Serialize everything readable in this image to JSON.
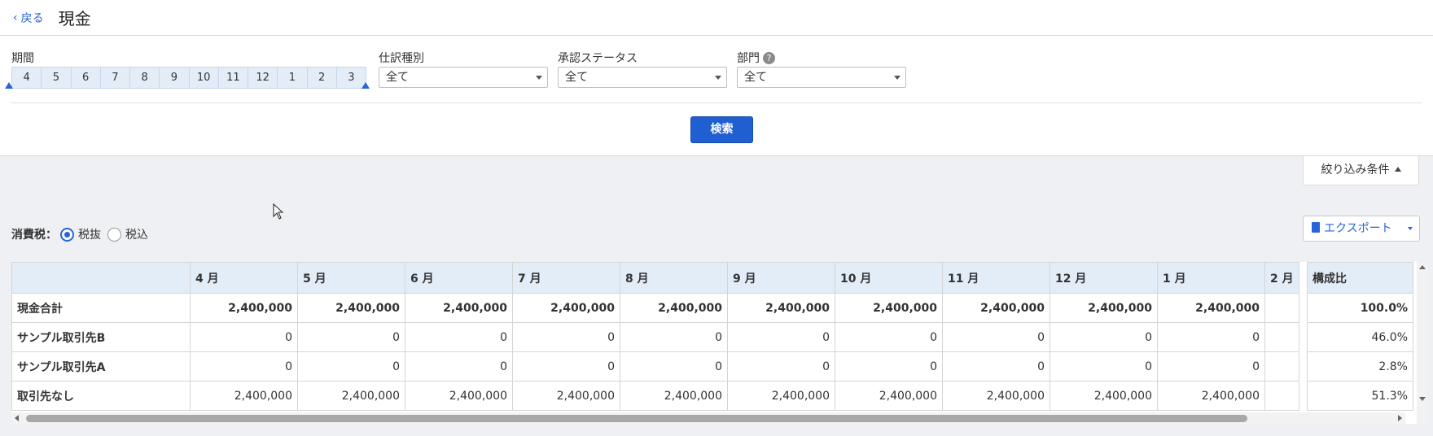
{
  "header": {
    "back_label": "戻る",
    "title": "現金"
  },
  "filters": {
    "period_label": "期間",
    "months": [
      "4",
      "5",
      "6",
      "7",
      "8",
      "9",
      "10",
      "11",
      "12",
      "1",
      "2",
      "3"
    ],
    "journal_type_label": "仕訳種別",
    "journal_type_value": "全て",
    "approval_label": "承認ステータス",
    "approval_value": "全て",
    "department_label": "部門",
    "department_value": "全て",
    "help_icon_glyph": "?",
    "search_label": "検索"
  },
  "toggle_label": "絞り込み条件",
  "tax": {
    "label": "消費税：",
    "option_excluded": "税抜",
    "option_included": "税込",
    "selected": "税抜"
  },
  "export_label": "エクスポート",
  "table": {
    "columns": [
      "4 月",
      "5 月",
      "6 月",
      "7 月",
      "8 月",
      "9 月",
      "10 月",
      "11 月",
      "12 月",
      "1 月",
      "2 月"
    ],
    "ratio_header": "構成比",
    "rows": [
      {
        "name": "現金合計",
        "values": [
          "2,400,000",
          "2,400,000",
          "2,400,000",
          "2,400,000",
          "2,400,000",
          "2,400,000",
          "2,400,000",
          "2,400,000",
          "2,400,000",
          "2,400,000",
          ""
        ],
        "ratio": "100.0%"
      },
      {
        "name": "サンプル取引先B",
        "values": [
          "0",
          "0",
          "0",
          "0",
          "0",
          "0",
          "0",
          "0",
          "0",
          "0",
          ""
        ],
        "ratio": "46.0%"
      },
      {
        "name": "サンプル取引先A",
        "values": [
          "0",
          "0",
          "0",
          "0",
          "0",
          "0",
          "0",
          "0",
          "0",
          "0",
          ""
        ],
        "ratio": "2.8%"
      },
      {
        "name": "取引先なし",
        "values": [
          "2,400,000",
          "2,400,000",
          "2,400,000",
          "2,400,000",
          "2,400,000",
          "2,400,000",
          "2,400,000",
          "2,400,000",
          "2,400,000",
          "2,400,000",
          ""
        ],
        "ratio": "51.3%"
      }
    ]
  }
}
